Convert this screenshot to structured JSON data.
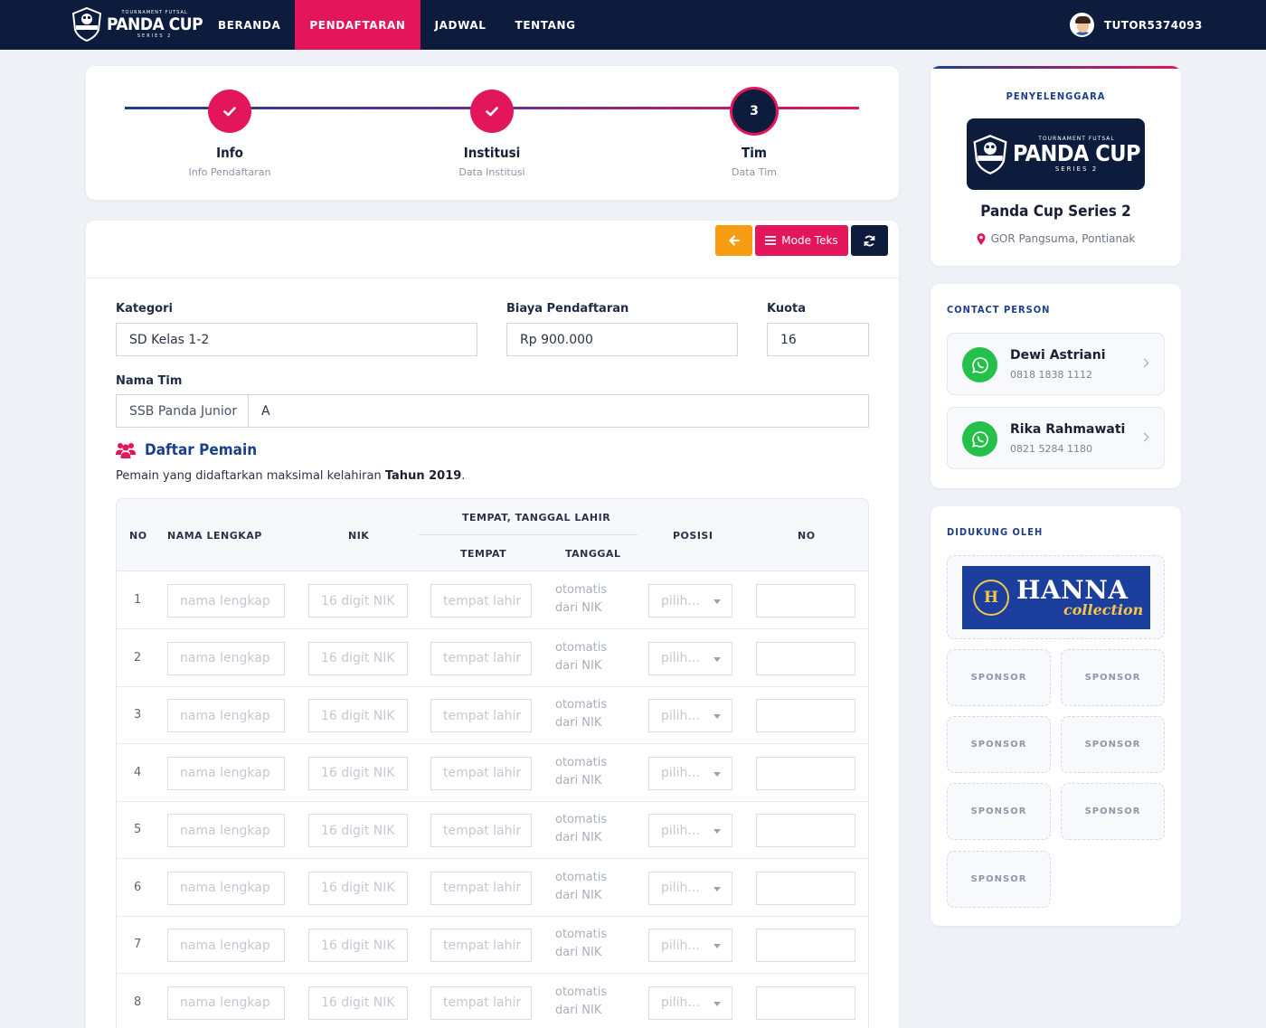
{
  "brand": {
    "small": "TOURNAMENT FUTSAL",
    "name": "PANDA CUP",
    "series": "SERIES 2",
    "shield_text": "PANDA CUP"
  },
  "nav": {
    "items": [
      {
        "label": "BERANDA",
        "active": false
      },
      {
        "label": "PENDAFTARAN",
        "active": true
      },
      {
        "label": "JADWAL",
        "active": false
      },
      {
        "label": "TENTANG",
        "active": false
      }
    ],
    "user": "TUTOR5374093"
  },
  "stepper": {
    "steps": [
      {
        "title": "Info",
        "subtitle": "Info Pendaftaran",
        "state": "done"
      },
      {
        "title": "Institusi",
        "subtitle": "Data Institusi",
        "state": "done"
      },
      {
        "title": "Tim",
        "subtitle": "Data Tim",
        "state": "current",
        "number": "3"
      }
    ]
  },
  "toolbar": {
    "back_icon": "arrow-left-icon",
    "text_mode_label": "Mode Teks",
    "refresh_icon": "refresh-icon"
  },
  "form": {
    "kategori_label": "Kategori",
    "kategori_value": "SD Kelas 1-2",
    "biaya_label": "Biaya Pendaftaran",
    "biaya_value": "Rp 900.000",
    "kuota_label": "Kuota",
    "kuota_value": "16",
    "nama_tim_label": "Nama Tim",
    "nama_tim_prefix": "SSB Panda Junior",
    "nama_tim_value": "A"
  },
  "players": {
    "title": "Daftar Pemain",
    "note_prefix": "Pemain yang didaftarkan maksimal kelahiran ",
    "note_bold": "Tahun 2019",
    "note_suffix": ".",
    "headers": {
      "no": "NO",
      "nama": "NAMA LENGKAP",
      "nik": "NIK",
      "ttl": "TEMPAT, TANGGAL LAHIR",
      "tempat": "TEMPAT",
      "tanggal": "TANGGAL",
      "posisi": "POSISI",
      "no_punggung": "NO"
    },
    "placeholders": {
      "nama": "nama lengkap",
      "nik": "16 digit NIK",
      "tempat": "tempat lahir",
      "tanggal_line1": "otomatis",
      "tanggal_line2": "dari NIK",
      "posisi": "pilih..."
    },
    "rows": [
      "1",
      "2",
      "3",
      "4",
      "5",
      "6",
      "7",
      "8"
    ]
  },
  "sidebar": {
    "organizer_title": "PENYELENGGARA",
    "organizer_name": "Panda Cup Series 2",
    "organizer_location": "GOR Pangsuma, Pontianak",
    "contact_title": "CONTACT PERSON",
    "contacts": [
      {
        "name": "Dewi Astriani",
        "phone": "0818 1838 1112"
      },
      {
        "name": "Rika Rahmawati",
        "phone": "0821 5284 1180"
      }
    ],
    "support_title": "DIDUKUNG OLEH",
    "main_sponsor": {
      "name": "HANNA",
      "tagline": "collection",
      "badge": "H"
    },
    "sponsor_slots": [
      "SPONSOR",
      "SPONSOR",
      "SPONSOR",
      "SPONSOR",
      "SPONSOR",
      "SPONSOR",
      "SPONSOR"
    ]
  },
  "colors": {
    "navy": "#0d1b3d",
    "accent": "#e3165b",
    "orange": "#f59c12",
    "whatsapp": "#25c04a",
    "blue": "#1c3f8a"
  }
}
